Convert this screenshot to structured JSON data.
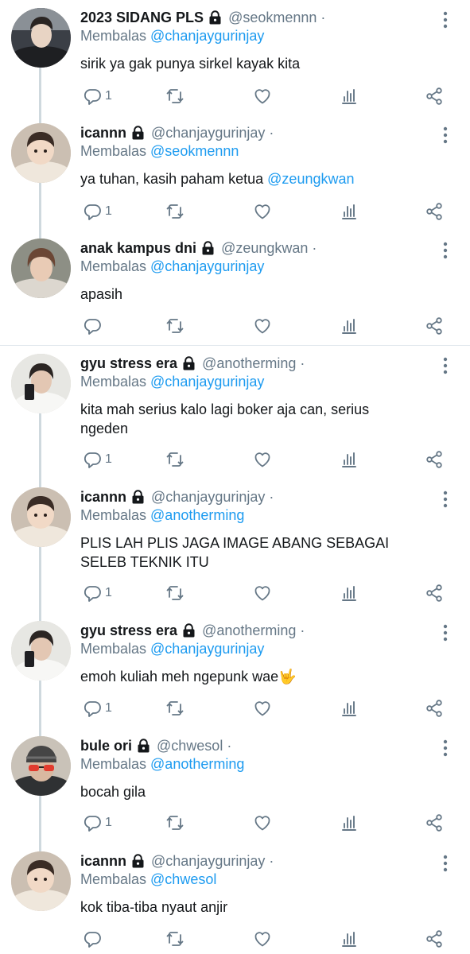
{
  "reply_prefix": "Membalas",
  "tweets": [
    {
      "name": "2023 SIDANG PLS",
      "handle": "@seokmennn",
      "dot": "·",
      "reply_to": "@chanjaygurinjay",
      "text": "sirik ya gak punya sirkel kayak kita",
      "mention": "",
      "reply_count": "1",
      "avatar": "boy-dark"
    },
    {
      "name": "icannn",
      "handle": "@chanjaygurinjay",
      "dot": "·",
      "reply_to": "@seokmennn",
      "text": "ya tuhan, kasih paham ketua ",
      "mention": "@zeungkwan",
      "reply_count": "1",
      "avatar": "baby"
    },
    {
      "name": "anak kampus dni",
      "handle": "@zeungkwan",
      "dot": "·",
      "reply_to": "@chanjaygurinjay",
      "text": "apasih",
      "mention": "",
      "reply_count": "",
      "avatar": "boy-brown"
    },
    {
      "name": "gyu stress era",
      "handle": "@anotherming",
      "dot": "·",
      "reply_to": "@chanjaygurinjay",
      "text": "kita mah serius kalo lagi boker aja can, serius\nngeden",
      "mention": "",
      "reply_count": "1",
      "avatar": "selfie"
    },
    {
      "name": "icannn",
      "handle": "@chanjaygurinjay",
      "dot": "·",
      "reply_to": "@anotherming",
      "text": "PLIS LAH PLIS JAGA IMAGE ABANG SEBAGAI\nSELEB TEKNIK ITU",
      "mention": "",
      "reply_count": "1",
      "avatar": "baby"
    },
    {
      "name": "gyu stress era",
      "handle": "@anotherming",
      "dot": "·",
      "reply_to": "@chanjaygurinjay",
      "text": "emoh kuliah meh ngepunk wae🤟",
      "mention": "",
      "reply_count": "1",
      "avatar": "selfie"
    },
    {
      "name": "bule ori",
      "handle": "@chwesol",
      "dot": "·",
      "reply_to": "@anotherming",
      "text": "bocah gila",
      "mention": "",
      "reply_count": "1",
      "avatar": "glasses"
    },
    {
      "name": "icannn",
      "handle": "@chanjaygurinjay",
      "dot": "·",
      "reply_to": "@chwesol",
      "text": "kok tiba-tiba nyaut anjir",
      "mention": "",
      "reply_count": "",
      "avatar": "baby"
    }
  ],
  "icons": [
    "lock-icon",
    "more-vertical-icon",
    "reply-icon",
    "retweet-icon",
    "like-icon",
    "analytics-icon",
    "share-icon"
  ],
  "colors": {
    "text": "#14171a",
    "muted": "#657786",
    "link": "#1d9bf0",
    "thread_line": "#cfd9de",
    "separator": "#e1e8ed"
  }
}
